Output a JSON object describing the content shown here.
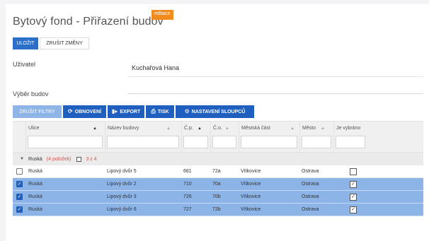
{
  "header": {
    "title": "Bytový fond - Přiřazení budov",
    "mode_badge": "editace"
  },
  "actions": {
    "save_label": "ULOŽIT",
    "cancel_label": "ZRUŠIT ZMĚNY"
  },
  "form": {
    "user_label": "Uživatel",
    "user_value": "Kuchařová Hana",
    "buildings_label": "Výběr budov"
  },
  "toolbar": {
    "clear_filters": "ZRUŠIT FILTRY",
    "refresh": "OBNOVENÍ",
    "export": "EXPORT",
    "print": "TISK",
    "column_settings": "NASTAVENÍ SLOUPCŮ"
  },
  "grid": {
    "columns": [
      {
        "label": "Ulice",
        "sort": "▲"
      },
      {
        "label": "Název budovy",
        "sort": "▲"
      },
      {
        "label": "Č.p.",
        "sort": "▲"
      },
      {
        "label": "Č.o.",
        "sort": "▲"
      },
      {
        "label": "Městská část",
        "sort": "▲"
      },
      {
        "label": "Město",
        "sort": "▲"
      },
      {
        "label": "Je vybráno",
        "sort": ""
      }
    ],
    "group": {
      "arrow": "▼",
      "name": "Ruská",
      "count_text": "(4 položek)",
      "selected_text": "3 z 4"
    },
    "rows": [
      {
        "ulice": "Ruská",
        "nazev": "Lipový dvůr 5",
        "cp": "681",
        "co": "72a",
        "cast": "Vítkovice",
        "mesto": "Ostrava",
        "selected": false,
        "vybrano": false
      },
      {
        "ulice": "Ruská",
        "nazev": "Lipový dvůr 2",
        "cp": "710",
        "co": "70a",
        "cast": "Vítkovice",
        "mesto": "Ostrava",
        "selected": true,
        "vybrano": true
      },
      {
        "ulice": "Ruská",
        "nazev": "Lipový dvůr 3",
        "cp": "726",
        "co": "70b",
        "cast": "Vítkovice",
        "mesto": "Ostrava",
        "selected": true,
        "vybrano": true
      },
      {
        "ulice": "Ruská",
        "nazev": "Lipový dvůr 6",
        "cp": "727",
        "co": "72b",
        "cast": "Vítkovice",
        "mesto": "Ostrava",
        "selected": true,
        "vybrano": true
      }
    ]
  },
  "icons": {
    "refresh": "refresh-icon",
    "export": "export-icon",
    "print": "print-icon",
    "settings": "gear-icon",
    "check": "check-icon"
  },
  "colors": {
    "primary": "#1e5fc0",
    "badge": "#f28a1c",
    "selected_row": "#8db4e6",
    "group_accent": "#d9534f"
  }
}
